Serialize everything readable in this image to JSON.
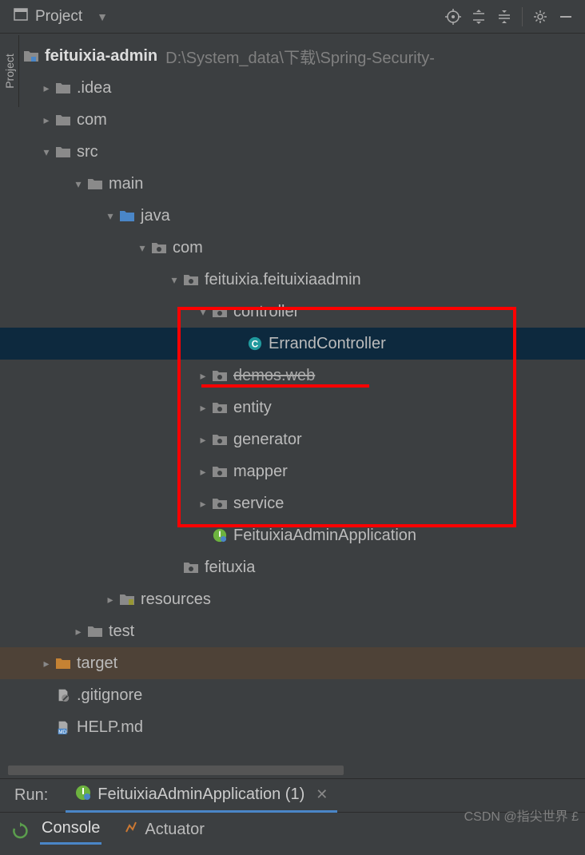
{
  "toolbar": {
    "project_label": "Project"
  },
  "side_tab": {
    "label": "Project"
  },
  "tree": {
    "root": {
      "name": "feituixia-admin",
      "path": "D:\\System_data\\下载\\Spring-Security-"
    },
    "idea": ".idea",
    "com1": "com",
    "src": "src",
    "main": "main",
    "java": "java",
    "com2": "com",
    "pkg": "feituixia.feituixiaadmin",
    "controller": "controller",
    "errand": "ErrandController",
    "demos": "demos.web",
    "entity": "entity",
    "generator": "generator",
    "mapper": "mapper",
    "service": "service",
    "app": "FeituixiaAdminApplication",
    "feituxia": "feituxia",
    "resources": "resources",
    "test": "test",
    "target": "target",
    "gitignore": ".gitignore",
    "help": "HELP.md"
  },
  "run": {
    "label": "Run:",
    "tab_name": "FeituixiaAdminApplication (1)",
    "console": "Console",
    "actuator": "Actuator"
  },
  "watermark": "CSDN @指尖世界  £"
}
